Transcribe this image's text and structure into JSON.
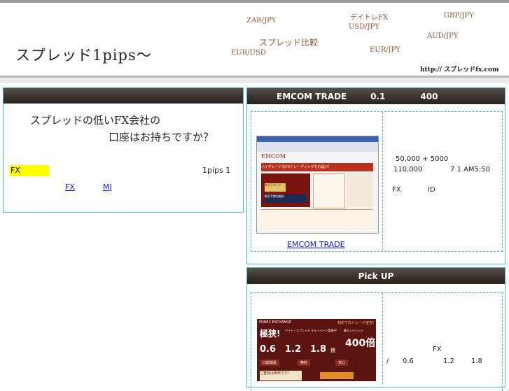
{
  "header": {
    "site_title": "スプレッド1pips～",
    "url": "http:// スプレッドfx.com",
    "keywords": [
      "ZAR/JPY",
      "デイトレFX",
      "GBP/JPY",
      "USD/JPY",
      "スプレッド比較",
      "AUD/JPY",
      "EUR/USD",
      "EUR/JPY"
    ]
  },
  "left": {
    "question_line1": "スプレッドの低いFX会社の",
    "question_line2": "口座はお持ちですか？",
    "highlight_label": "FX",
    "pips_text": "1pips 1",
    "link1": "FX",
    "link2": "MJ"
  },
  "emcom": {
    "heading_name": "EMCOM TRADE",
    "heading_value1": "0.1",
    "heading_value2": "400",
    "image_caption": "EMCOM TRADE",
    "line1": "50,000 + 5000",
    "line2_a": "110,000",
    "line2_b": "7 1 AM5:50",
    "line3_a": "FX",
    "line3_b": "ID",
    "screenshot": {
      "logo": "EMCOM",
      "banner": "ハイグレードなFXトレーディングをお届け!",
      "badge1": "キャンペーン",
      "badge2": "取引手数料無料"
    }
  },
  "pickup": {
    "heading": "Pick UP",
    "fx_label": "FX",
    "slash": "/",
    "v1": "0.6",
    "v2": "1.2",
    "v3": "1.8",
    "banner": {
      "brand": "FOREX EXCHANGE",
      "tag": "初めてのトレード宣言!",
      "headline": "極狭!",
      "sub": "デイト・スプレッド キャンペーン実施中!",
      "leverage_label": "最大レバレッジ",
      "leverage": "400倍",
      "s1": "0.6",
      "s2": "1.2",
      "s3": "1.8",
      "unit": "銭",
      "items": [
        "口座開設",
        "無料",
        "安心"
      ],
      "note": "ご登録は簡単です!"
    }
  },
  "colors": {
    "accent": "#4bb5c5",
    "bar": "#3a332c",
    "link": "#1a1adb",
    "highlight": "#ffff00"
  }
}
